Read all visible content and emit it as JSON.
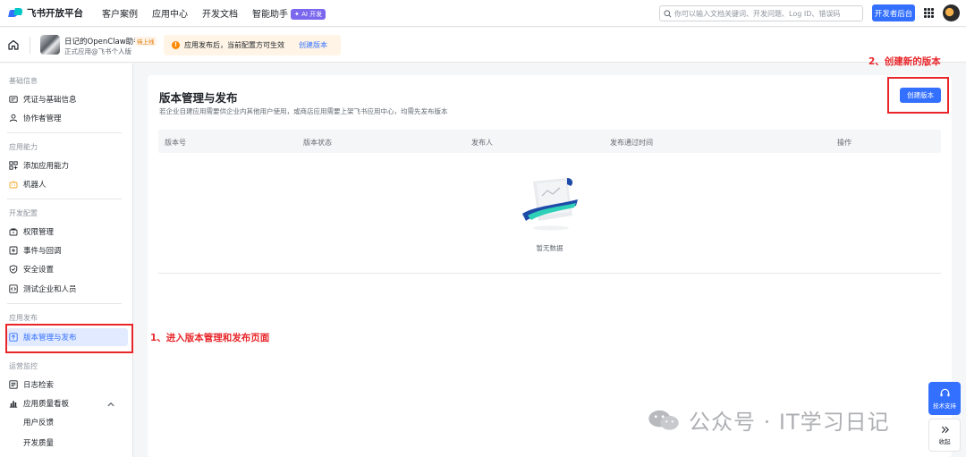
{
  "topbar": {
    "logo_text": "飞书开放平台",
    "nav": [
      {
        "label": "客户案例"
      },
      {
        "label": "应用中心"
      },
      {
        "label": "开发文档"
      },
      {
        "label": "智能助手"
      }
    ],
    "ai_badge": "✦ AI 开发",
    "search_placeholder": "你可以输入文档关键词、开发问题、Log ID、错误码",
    "console_button": "开发者后台"
  },
  "appbar": {
    "app_name": "日记的OpenClaw助手",
    "app_status": "待上线",
    "app_sub": "正式应用@飞书个人版",
    "notice_text": "应用发布后，当前配置方可生效",
    "notice_link": "创建版本"
  },
  "sidebar": {
    "groups": [
      {
        "title": "基础信息",
        "items": [
          {
            "label": "凭证与基础信息",
            "icon": "credential-icon"
          },
          {
            "label": "协作者管理",
            "icon": "user-icon"
          }
        ]
      },
      {
        "title": "应用能力",
        "items": [
          {
            "label": "添加应用能力",
            "icon": "grid-add-icon"
          },
          {
            "label": "机器人",
            "icon": "robot-icon"
          }
        ]
      },
      {
        "title": "开发配置",
        "items": [
          {
            "label": "权限管理",
            "icon": "permission-icon"
          },
          {
            "label": "事件与回调",
            "icon": "event-icon"
          },
          {
            "label": "安全设置",
            "icon": "shield-icon"
          },
          {
            "label": "测试企业和人员",
            "icon": "code-icon"
          }
        ]
      },
      {
        "title": "应用发布",
        "items": [
          {
            "label": "版本管理与发布",
            "icon": "upload-icon",
            "active": true
          }
        ]
      },
      {
        "title": "运营监控",
        "items": [
          {
            "label": "日志检索",
            "icon": "log-icon"
          },
          {
            "label": "应用质量看板",
            "icon": "chart-icon"
          }
        ]
      }
    ],
    "sub_items": [
      {
        "label": "用户反馈"
      },
      {
        "label": "开发质量"
      }
    ]
  },
  "main": {
    "title": "版本管理与发布",
    "description": "若企业自建应用需要供企业内其他用户使用，或商店应用需要上架飞书应用中心，均需先发布版本",
    "create_button": "创建版本",
    "columns": [
      "版本号",
      "版本状态",
      "发布人",
      "发布通过时间",
      "操作"
    ],
    "empty_text": "暂无数据"
  },
  "annotations": {
    "step1": "1、进入版本管理和发布页面",
    "step2": "2、创建新的版本",
    "color": "#e8262a"
  },
  "watermark": {
    "text": "公众号 · IT学习日记"
  },
  "float": {
    "support_label": "技术支持",
    "collapse_label": "收起"
  },
  "colors": {
    "accent": "#3370ff",
    "active_bg": "#e1eaff",
    "warning": "#ff8800"
  }
}
